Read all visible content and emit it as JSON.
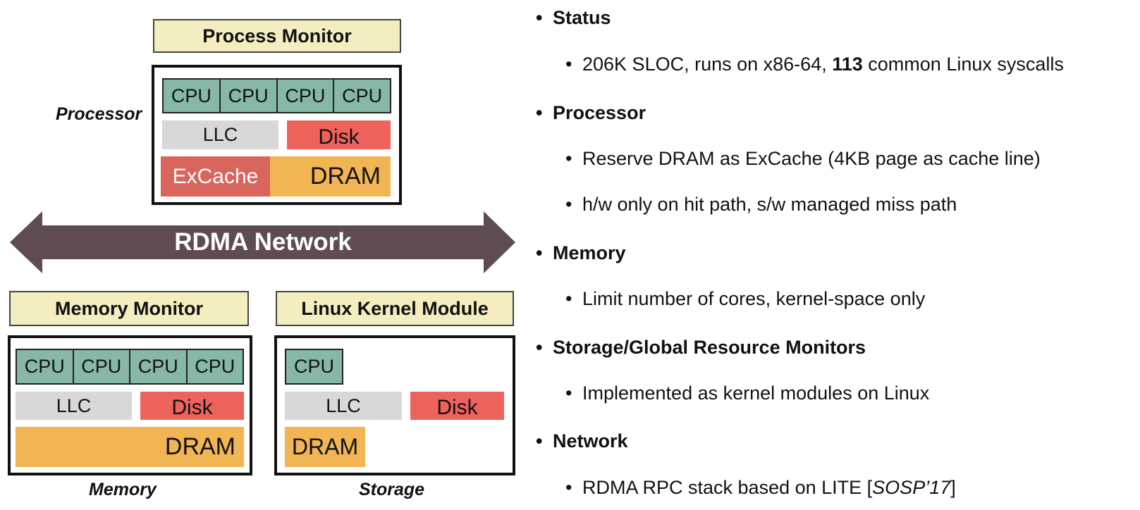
{
  "colors": {
    "cpu": "#86b7a9",
    "llc": "#d8d8d8",
    "disk": "#ee625c",
    "dram": "#f2b553",
    "excache": "#d8665c",
    "title_box": "#f3edc0",
    "network_arrow": "#5e4c50"
  },
  "diagram": {
    "process_monitor": {
      "title": "Process Monitor",
      "side_label": "Processor",
      "cpus": [
        "CPU",
        "CPU",
        "CPU",
        "CPU"
      ],
      "llc": "LLC",
      "disk": "Disk",
      "excache": "ExCache",
      "dram": "DRAM"
    },
    "network": {
      "label": "RDMA Network"
    },
    "memory_monitor": {
      "title": "Memory Monitor",
      "side_label": "Memory",
      "cpus": [
        "CPU",
        "CPU",
        "CPU",
        "CPU"
      ],
      "llc": "LLC",
      "disk": "Disk",
      "dram": "DRAM"
    },
    "kernel_module": {
      "title": "Linux Kernel Module",
      "side_label": "Storage",
      "cpus": [
        "CPU"
      ],
      "llc": "LLC",
      "disk": "Disk",
      "dram": "DRAM"
    }
  },
  "bullets": [
    {
      "heading": "Status",
      "items": [
        {
          "pre": "206K SLOC, runs on x86-64, ",
          "bold": "113",
          "post": " common Linux syscalls"
        }
      ]
    },
    {
      "heading": "Processor",
      "items": [
        {
          "text": "Reserve DRAM as ExCache (4KB page as cache line)"
        },
        {
          "text": "h/w only on hit path, s/w managed miss path"
        }
      ]
    },
    {
      "heading": "Memory",
      "items": [
        {
          "text": "Limit number of cores, kernel-space only"
        }
      ]
    },
    {
      "heading": "Storage/Global Resource Monitors",
      "items": [
        {
          "text": "Implemented as kernel modules on Linux"
        }
      ]
    },
    {
      "heading": "Network",
      "items": [
        {
          "pre": "RDMA RPC stack based on LITE [",
          "italic": "SOSP’17",
          "post": "]"
        }
      ]
    }
  ]
}
